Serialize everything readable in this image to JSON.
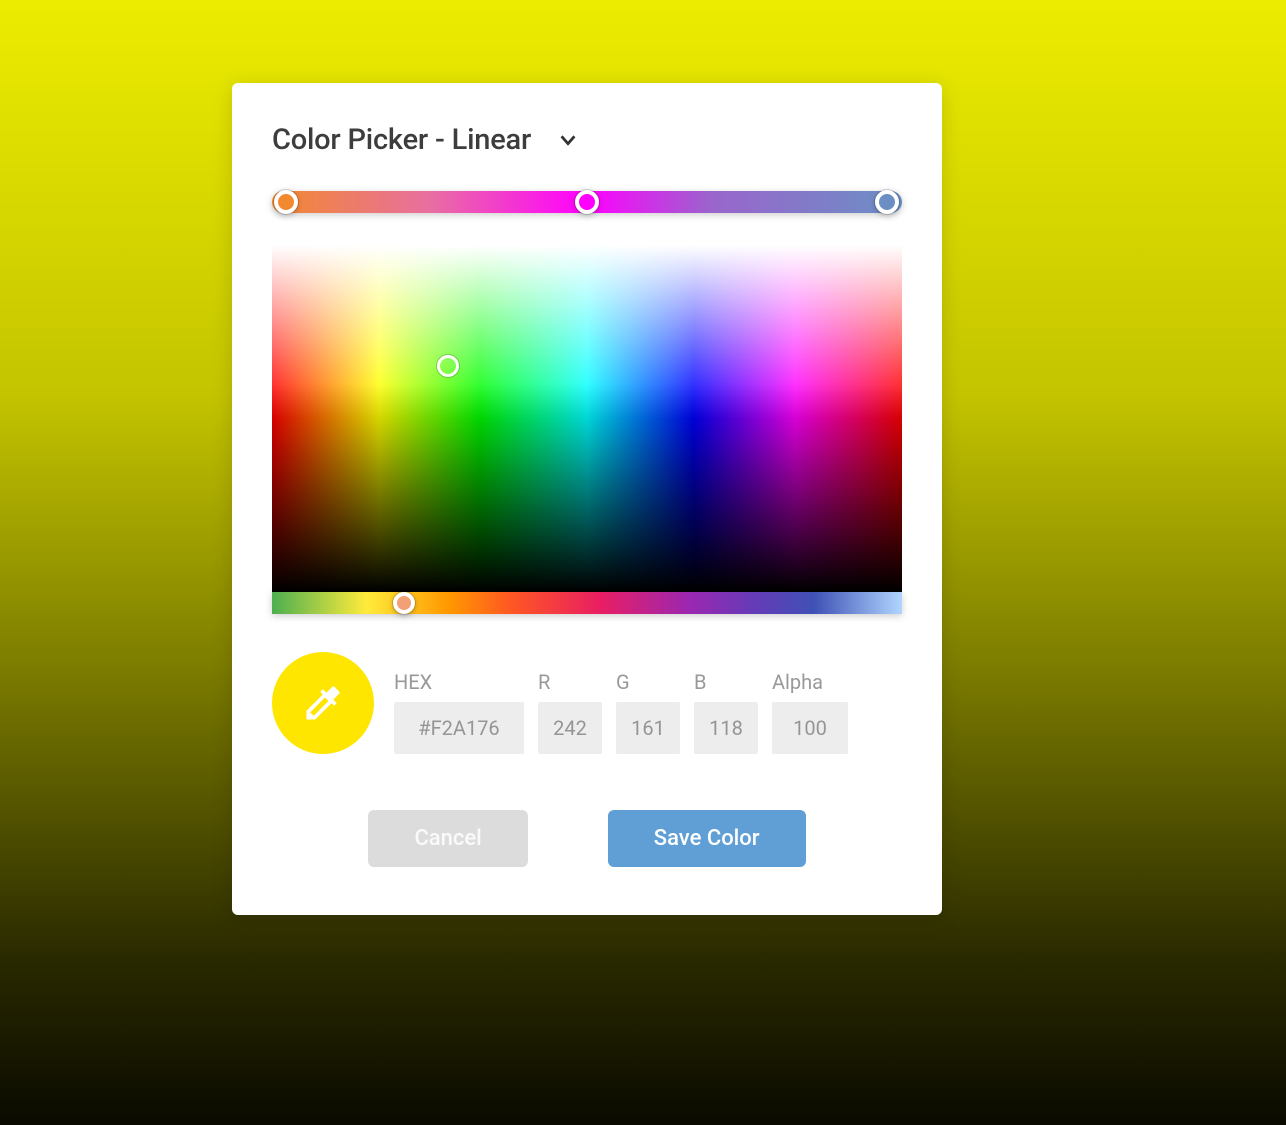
{
  "header": {
    "title": "Color Picker - Linear"
  },
  "gradient": {
    "stops": [
      {
        "pos": 2.2,
        "color": "#f2892e"
      },
      {
        "pos": 50,
        "color": "#ff00ff"
      },
      {
        "pos": 97.6,
        "color": "#6b8fc4"
      }
    ]
  },
  "spectrum": {
    "picker_x_pct": 28,
    "picker_y_pct": 35
  },
  "hue": {
    "handle_pct": 21,
    "handle_color": "#f2a176"
  },
  "fields": {
    "hex": {
      "label": "HEX",
      "value": "#F2A176"
    },
    "r": {
      "label": "R",
      "value": "242"
    },
    "g": {
      "label": "G",
      "value": "161"
    },
    "b": {
      "label": "B",
      "value": "118"
    },
    "alpha": {
      "label": "Alpha",
      "value": "100"
    }
  },
  "eyedropper_color": "#fee600",
  "actions": {
    "cancel": "Cancel",
    "save": "Save Color"
  }
}
